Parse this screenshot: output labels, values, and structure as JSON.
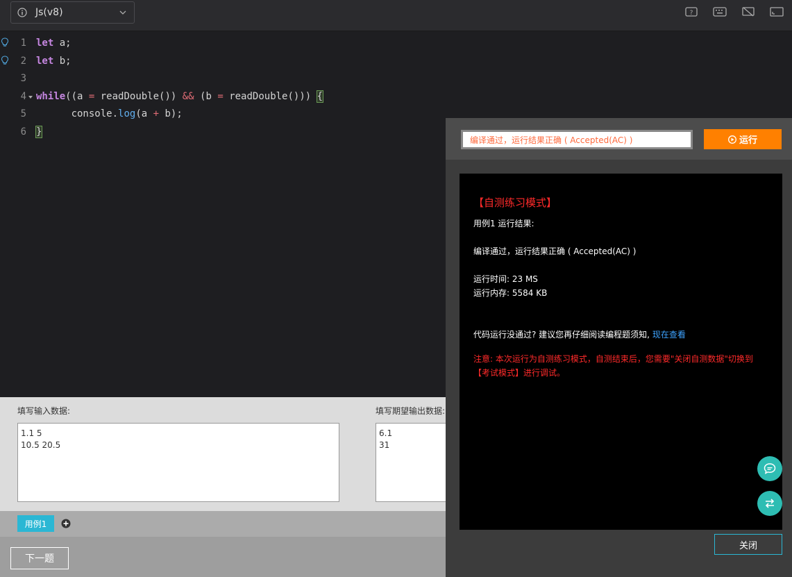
{
  "toolbar": {
    "language": "Js(v8)"
  },
  "editor": {
    "line_numbers": [
      "1",
      "2",
      "3",
      "4",
      "5",
      "6"
    ]
  },
  "io": {
    "input_label": "填写输入数据:",
    "input_value": "1.1 5\n10.5 20.5",
    "expected_label": "填写期望输出数据:",
    "expected_value": "6.1\n31"
  },
  "cases": {
    "tab_label": "用例1"
  },
  "footer": {
    "next_label": "下一题"
  },
  "result": {
    "status_text": "编译通过，运行结果正确 ( Accepted(AC) )",
    "run_label": "运行",
    "mode_title": "【自测练习模式】",
    "case_result_label": "用例1 运行结果:",
    "status_line": "编译通过，运行结果正确 ( Accepted(AC) )",
    "time_line": "运行时间: 23 MS",
    "memory_line": "运行内存: 5584 KB",
    "help_text": "代码运行没通过? 建议您再仔细阅读编程题须知,",
    "help_link": "现在查看",
    "warn_line1": "注意: 本次运行为自测练习模式，自测结束后，您需要\"关闭自测数据\"切换到",
    "warn_line2": "【考试模式】进行调试。",
    "close_label": "关闭"
  },
  "colors": {
    "accent_orange": "#ff8000",
    "accent_cyan": "#2bb7d4",
    "float_teal": "#2ebdb3",
    "error_red": "#ff2a2a"
  }
}
